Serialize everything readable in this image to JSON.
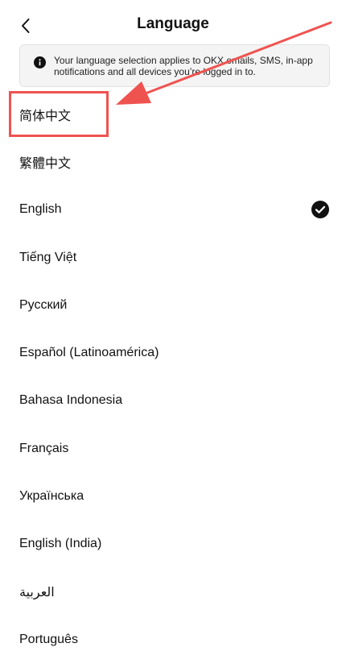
{
  "header": {
    "title": "Language"
  },
  "notice": {
    "text": "Your language selection applies to OKX emails, SMS, in-app notifications and all devices you’re logged in to."
  },
  "languages": [
    {
      "label": "简体中文",
      "selected": false
    },
    {
      "label": "繁體中文",
      "selected": false
    },
    {
      "label": "English",
      "selected": true
    },
    {
      "label": "Tiếng Việt",
      "selected": false
    },
    {
      "label": "Русский",
      "selected": false
    },
    {
      "label": "Español (Latinoamérica)",
      "selected": false
    },
    {
      "label": "Bahasa Indonesia",
      "selected": false
    },
    {
      "label": "Français",
      "selected": false
    },
    {
      "label": "Українська",
      "selected": false
    },
    {
      "label": "English (India)",
      "selected": false
    },
    {
      "label": "العربية",
      "selected": false
    },
    {
      "label": "Português",
      "selected": false
    }
  ],
  "colors": {
    "annotation": "#ef5350",
    "check_fill": "#111111",
    "notice_bg": "#f4f4f4"
  },
  "icons": {
    "back": "chevron-left-icon",
    "info": "info-icon",
    "check": "check-circle-icon"
  }
}
